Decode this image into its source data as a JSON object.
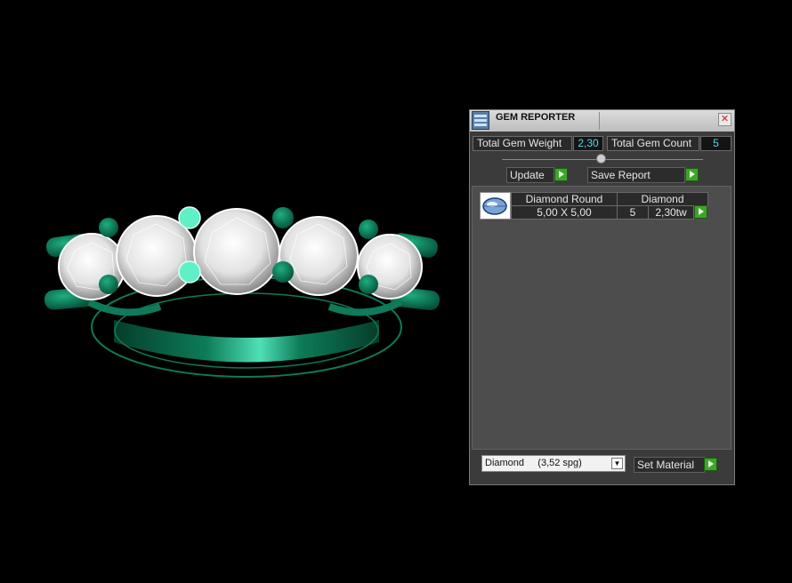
{
  "panel": {
    "title": "GEM REPORTER",
    "total_weight_label": "Total Gem Weight",
    "total_weight_value": "2,30",
    "total_count_label": "Total Gem Count",
    "total_count_value": "5",
    "update_label": "Update",
    "save_report_label": "Save Report",
    "gem_row": {
      "name": "Diamond Round",
      "material": "Diamond",
      "size": "5,00 X 5,00",
      "count": "5",
      "weight": "2,30tw"
    },
    "material_select": "Diamond     (3,52 spg)",
    "set_material_label": "Set Material",
    "close_icon": "close-icon",
    "dropdown_icon": "chevron-down-icon",
    "app_icon": "gem-reporter-icon"
  },
  "colors": {
    "metal": "#0f7a5a",
    "highlight": "#3fd6b0",
    "accent_green": "#3ea52a",
    "value_text": "#5ad6e6"
  }
}
